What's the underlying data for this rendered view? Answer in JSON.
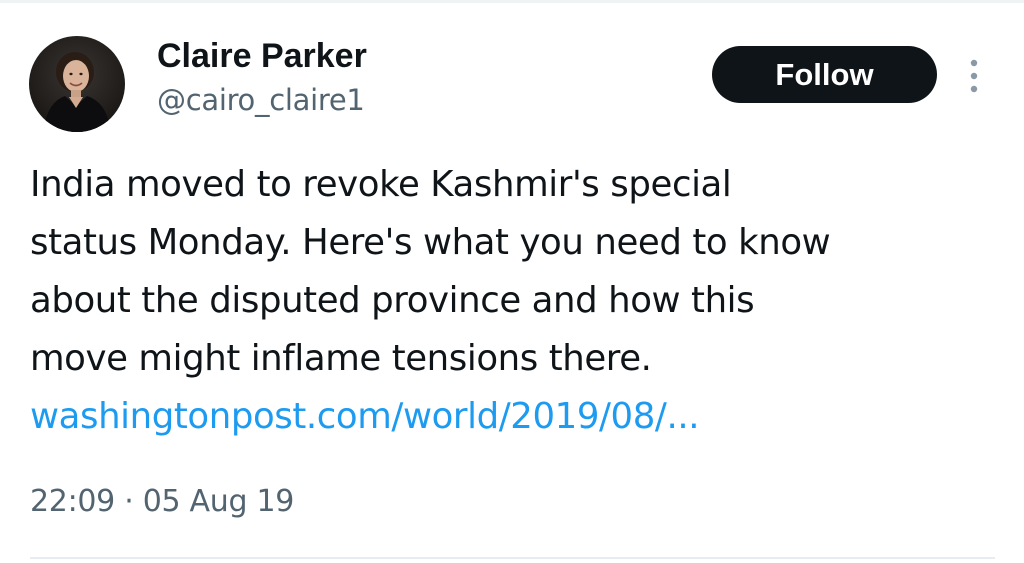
{
  "author": {
    "display_name": "Claire Parker",
    "handle": "@cairo_claire1",
    "avatar_icon": "profile-photo"
  },
  "actions": {
    "follow_label": "Follow",
    "more_icon": "more-vertical-icon"
  },
  "tweet": {
    "text_lines": [
      "India moved to revoke Kashmir's special",
      "status Monday. Here's what you need to know",
      "about the disputed province and how this",
      "move might inflame tensions there."
    ],
    "link_text": "washingtonpost.com/world/2019/08/...",
    "time": "22:09",
    "separator": "·",
    "date": "05 Aug 19"
  },
  "colors": {
    "text_primary": "#0f1419",
    "text_secondary": "#536471",
    "link": "#1d9bf0",
    "button_bg": "#0f1419",
    "button_text": "#ffffff"
  }
}
